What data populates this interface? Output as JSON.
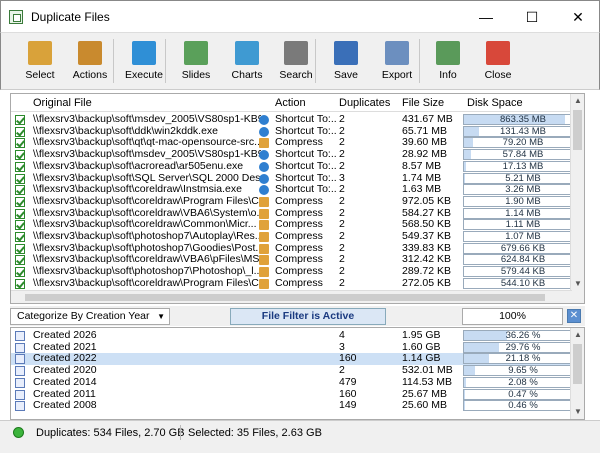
{
  "window": {
    "title": "Duplicate Files",
    "minimize": "—",
    "maximize": "☐",
    "close": "✕"
  },
  "toolbar": [
    {
      "label": "Select",
      "icon": "select-icon",
      "color": "#d9a23a"
    },
    {
      "label": "Actions",
      "icon": "actions-icon",
      "color": "#c98a2e"
    },
    {
      "label": "Execute",
      "icon": "execute-icon",
      "color": "#2f8fd6"
    },
    {
      "label": "Slides",
      "icon": "slides-icon",
      "color": "#5aa05a"
    },
    {
      "label": "Charts",
      "icon": "charts-icon",
      "color": "#3f9ad2"
    },
    {
      "label": "Search",
      "icon": "search-icon",
      "color": "#7a7a7a"
    },
    {
      "label": "Save",
      "icon": "save-icon",
      "color": "#3a6fb8"
    },
    {
      "label": "Export",
      "icon": "export-icon",
      "color": "#6c8fbf"
    },
    {
      "label": "Info",
      "icon": "info-icon",
      "color": "#5a9a5a"
    },
    {
      "label": "Close",
      "icon": "close-icon",
      "color": "#d8483a"
    }
  ],
  "files": {
    "columns": [
      "Original File",
      "Action",
      "Duplicates",
      "File Size",
      "Disk Space"
    ],
    "rows": [
      {
        "file": "\\\\flexsrv3\\backup\\soft\\msdev_2005\\VS80sp1-KB9...",
        "action": "Shortcut To:...",
        "type": "shortcut",
        "dup": "2",
        "size": "431.67 MB",
        "disk": "863.35 MB",
        "pct": 0.86
      },
      {
        "file": "\\\\flexsrv3\\backup\\soft\\ddk\\win2kddk.exe",
        "action": "Shortcut To:...",
        "type": "shortcut",
        "dup": "2",
        "size": "65.71 MB",
        "disk": "131.43 MB",
        "pct": 0.13
      },
      {
        "file": "\\\\flexsrv3\\backup\\soft\\qt\\qt-mac-opensource-src...",
        "action": "Compress",
        "type": "compress",
        "dup": "2",
        "size": "39.60 MB",
        "disk": "79.20 MB",
        "pct": 0.08
      },
      {
        "file": "\\\\flexsrv3\\backup\\soft\\msdev_2005\\VS80sp1-KB9...",
        "action": "Shortcut To:...",
        "type": "shortcut",
        "dup": "2",
        "size": "28.92 MB",
        "disk": "57.84 MB",
        "pct": 0.06
      },
      {
        "file": "\\\\flexsrv3\\backup\\soft\\acroread\\ar505enu.exe",
        "action": "Shortcut To:...",
        "type": "shortcut",
        "dup": "2",
        "size": "8.57 MB",
        "disk": "17.13 MB",
        "pct": 0.02
      },
      {
        "file": "\\\\flexsrv3\\backup\\soft\\SQL Server\\SQL 2000 Deskt...",
        "action": "Shortcut To:...",
        "type": "shortcut",
        "dup": "3",
        "size": "1.74 MB",
        "disk": "5.21 MB",
        "pct": 0.01
      },
      {
        "file": "\\\\flexsrv3\\backup\\soft\\coreldraw\\Instmsia.exe",
        "action": "Shortcut To:...",
        "type": "shortcut",
        "dup": "2",
        "size": "1.63 MB",
        "disk": "3.26 MB",
        "pct": 0.0
      },
      {
        "file": "\\\\flexsrv3\\backup\\soft\\coreldraw\\Program Files\\C...",
        "action": "Compress",
        "type": "compress",
        "dup": "2",
        "size": "972.05 KB",
        "disk": "1.90 MB",
        "pct": 0.0
      },
      {
        "file": "\\\\flexsrv3\\backup\\soft\\coreldraw\\VBA6\\System\\o...",
        "action": "Compress",
        "type": "compress",
        "dup": "2",
        "size": "584.27 KB",
        "disk": "1.14 MB",
        "pct": 0.0
      },
      {
        "file": "\\\\flexsrv3\\backup\\soft\\coreldraw\\Common\\Micr...",
        "action": "Compress",
        "type": "compress",
        "dup": "2",
        "size": "568.50 KB",
        "disk": "1.11 MB",
        "pct": 0.0
      },
      {
        "file": "\\\\flexsrv3\\backup\\soft\\photoshop7\\Autoplay\\Res...",
        "action": "Compress",
        "type": "compress",
        "dup": "2",
        "size": "549.37 KB",
        "disk": "1.07 MB",
        "pct": 0.0
      },
      {
        "file": "\\\\flexsrv3\\backup\\soft\\photoshop7\\Goodies\\Post...",
        "action": "Compress",
        "type": "compress",
        "dup": "2",
        "size": "339.83 KB",
        "disk": "679.66 KB",
        "pct": 0.0
      },
      {
        "file": "\\\\flexsrv3\\backup\\soft\\coreldraw\\VBA6\\pFiles\\MS...",
        "action": "Compress",
        "type": "compress",
        "dup": "2",
        "size": "312.42 KB",
        "disk": "624.84 KB",
        "pct": 0.0
      },
      {
        "file": "\\\\flexsrv3\\backup\\soft\\photoshop7\\Photoshop\\_l...",
        "action": "Compress",
        "type": "compress",
        "dup": "2",
        "size": "289.72 KB",
        "disk": "579.44 KB",
        "pct": 0.0
      },
      {
        "file": "\\\\flexsrv3\\backup\\soft\\coreldraw\\Program Files\\C...",
        "action": "Compress",
        "type": "compress",
        "dup": "2",
        "size": "272.05 KB",
        "disk": "544.10 KB",
        "pct": 0.0
      }
    ]
  },
  "filter_bar": {
    "categorize": "Categorize By Creation Year",
    "filter_label": "File Filter is Active",
    "percent": "100%",
    "close": "✕"
  },
  "categories": [
    {
      "name": "Created 2026",
      "count": "4",
      "size": "1.95 GB",
      "pct_text": "36.26 %",
      "pct": 0.3626
    },
    {
      "name": "Created 2021",
      "count": "3",
      "size": "1.60 GB",
      "pct_text": "29.76 %",
      "pct": 0.2976
    },
    {
      "name": "Created 2022",
      "count": "160",
      "size": "1.14 GB",
      "pct_text": "21.18 %",
      "pct": 0.2118,
      "selected": true
    },
    {
      "name": "Created 2020",
      "count": "2",
      "size": "532.01 MB",
      "pct_text": "9.65 %",
      "pct": 0.0965
    },
    {
      "name": "Created 2014",
      "count": "479",
      "size": "114.53 MB",
      "pct_text": "2.08 %",
      "pct": 0.0208
    },
    {
      "name": "Created 2011",
      "count": "160",
      "size": "25.67 MB",
      "pct_text": "0.47 %",
      "pct": 0.0047
    },
    {
      "name": "Created 2008",
      "count": "149",
      "size": "25.60 MB",
      "pct_text": "0.46 %",
      "pct": 0.0046
    }
  ],
  "status": {
    "duplicates": "Duplicates: 534 Files, 2.70 GB",
    "selected": "Selected: 35 Files, 2.63 GB"
  },
  "colors": {
    "bar_fill": "#c7dbf2",
    "status_ok": "#3cb43c",
    "shortcut": "#2f7fd0",
    "compress": "#e0a23a"
  }
}
